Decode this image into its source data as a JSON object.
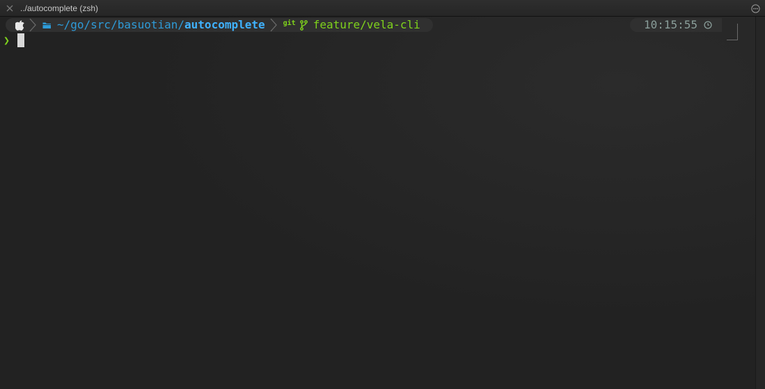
{
  "window": {
    "tab_title": "../autocomplete (zsh)"
  },
  "prompt": {
    "os_icon": "apple-icon",
    "path_prefix": "~/go/src/basuotian/",
    "path_current": "autocomplete",
    "vcs_label": "git",
    "branch": "feature/vela-cli",
    "time": "10:15:55",
    "prompt_char": "❯"
  },
  "colors": {
    "background": "#222222",
    "path": "#2e9bd8",
    "path_bold": "#3fb2ff",
    "git": "#7fd31c",
    "time": "#8a9e9a",
    "segment_bg": "#303030"
  },
  "icons": {
    "tab_close": "close-icon",
    "tab_menu": "more-icon",
    "folder": "folder-icon",
    "branch": "git-branch-icon",
    "clock": "clock-icon"
  }
}
